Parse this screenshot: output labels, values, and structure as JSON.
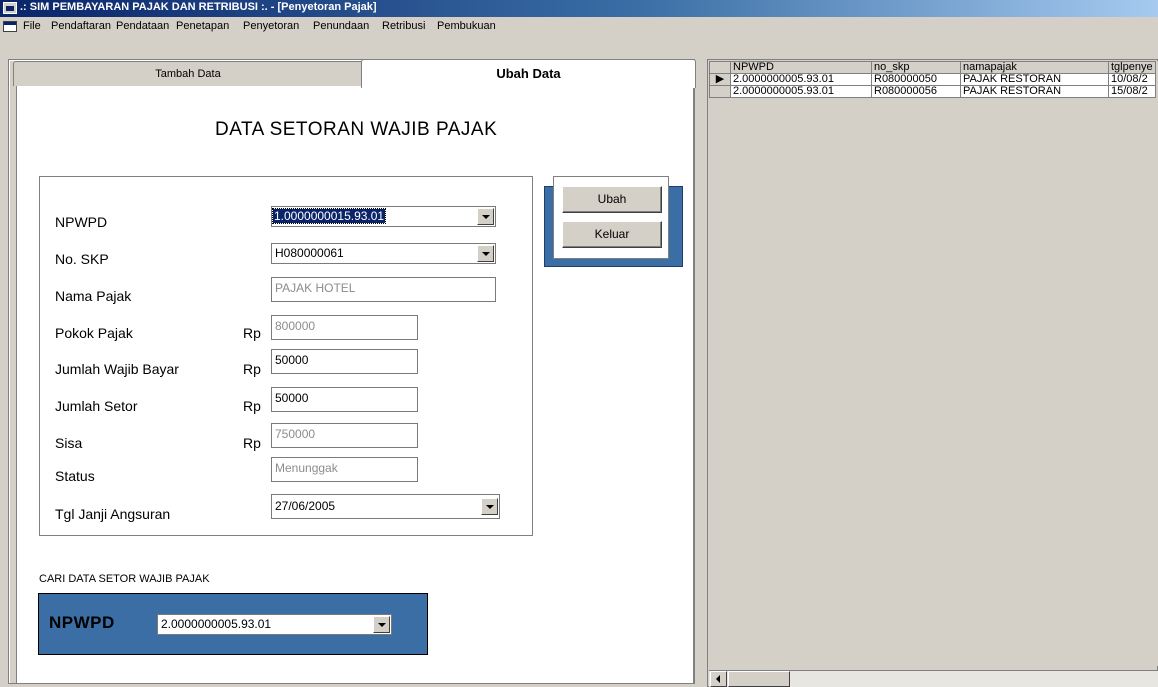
{
  "window": {
    "title": ".: SIM PEMBAYARAN PAJAK DAN RETRIBUSI :. - [Penyetoran Pajak]"
  },
  "menu": [
    "File",
    "Pendaftaran",
    "Pendataan",
    "Penetapan",
    "Penyetoran",
    "Penundaan",
    "Retribusi",
    "Pembukuan"
  ],
  "tabs": {
    "tambah": "Tambah Data",
    "ubah": "Ubah Data"
  },
  "form": {
    "heading": "DATA SETORAN WAJIB PAJAK",
    "currency": "Rp",
    "npwpd": {
      "label": "NPWPD",
      "value": "1.0000000015.93.01"
    },
    "no_skp": {
      "label": "No. SKP",
      "value": "H080000061"
    },
    "nama_pajak": {
      "label": "Nama Pajak",
      "value": "PAJAK HOTEL"
    },
    "pokok_pajak": {
      "label": "Pokok Pajak",
      "value": "800000"
    },
    "jumlah_wajib_bayar": {
      "label": "Jumlah Wajib Bayar",
      "value": "50000"
    },
    "jumlah_setor": {
      "label": "Jumlah Setor",
      "value": "50000"
    },
    "sisa": {
      "label": "Sisa",
      "value": "750000"
    },
    "status": {
      "label": "Status",
      "value": "Menunggak"
    },
    "tgl_janji": {
      "label": "Tgl Janji  Angsuran",
      "value": "27/06/2005"
    }
  },
  "buttons": {
    "ubah": "Ubah",
    "keluar": "Keluar"
  },
  "search": {
    "caption": "CARI DATA SETOR WAJIB PAJAK",
    "label": "NPWPD",
    "value": "2.0000000005.93.01"
  },
  "grid": {
    "columns": [
      "NPWPD",
      "no_skp",
      "namapajak",
      "tglpenye"
    ],
    "rows": [
      [
        "2.0000000005.93.01",
        "R080000050",
        "PAJAK RESTORAN",
        "10/08/2"
      ],
      [
        "2.0000000005.93.01",
        "R080000056",
        "PAJAK RESTORAN",
        "15/08/2"
      ]
    ]
  }
}
